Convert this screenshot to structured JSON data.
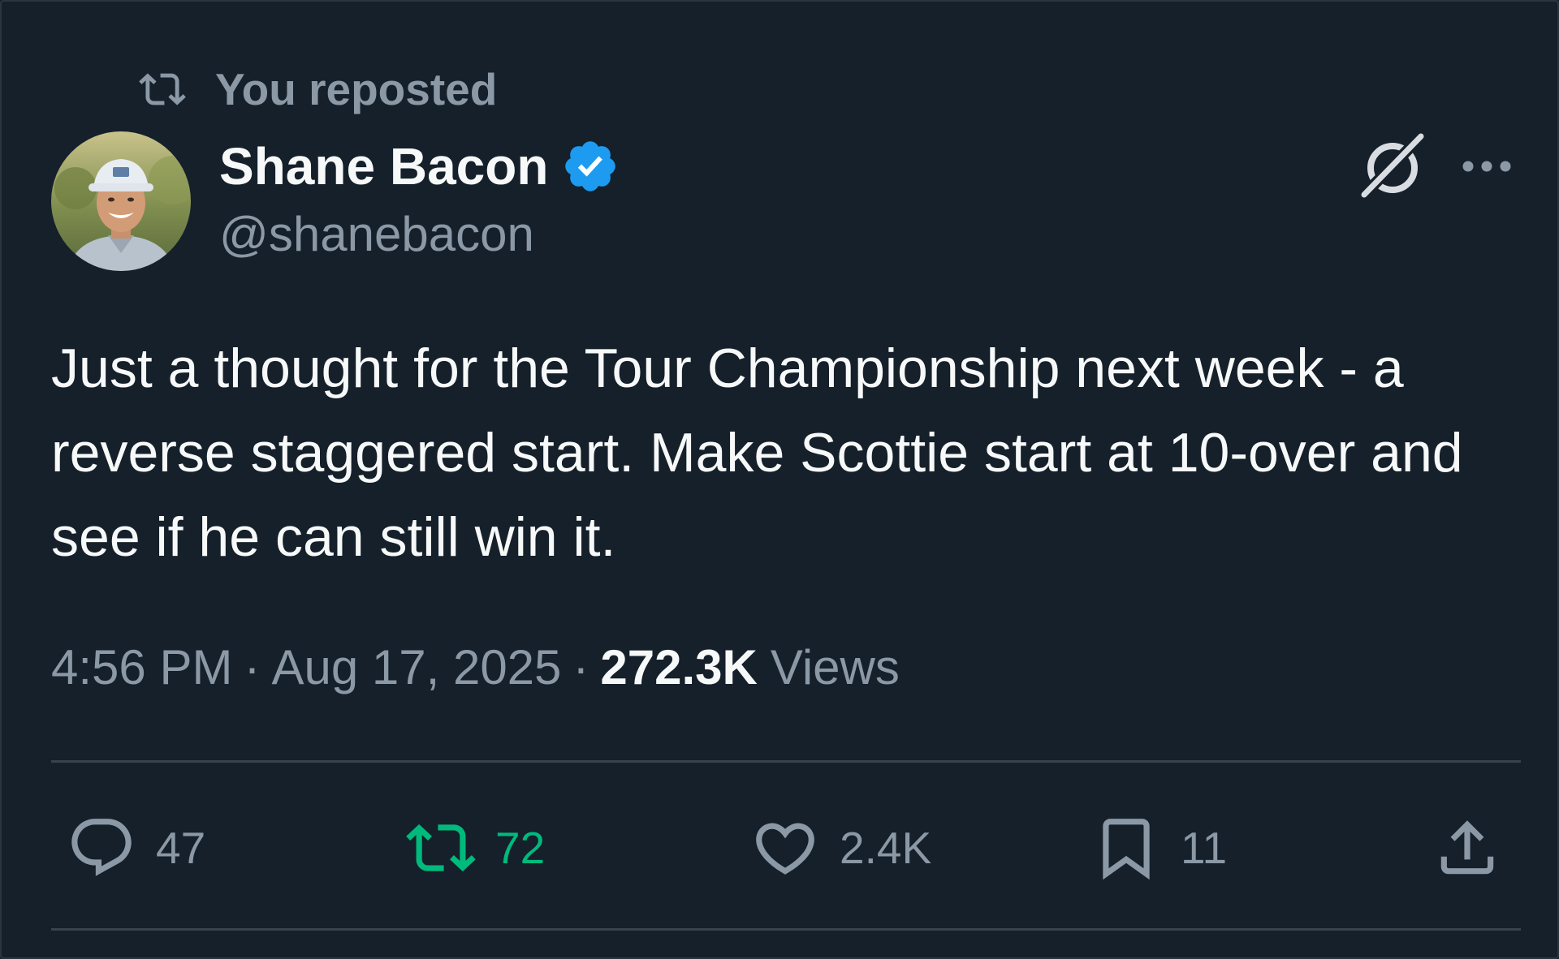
{
  "repost": {
    "label": "You reposted",
    "icon": "repost-icon"
  },
  "author": {
    "name": "Shane Bacon",
    "handle": "@shanebacon",
    "verified": true,
    "verified_color": "#1d9bf0"
  },
  "tweet": {
    "text": "Just a thought for the Tour Championship next week - a reverse staggered start. Make Scottie start at 10-over and see if he can still win it.",
    "time": "4:56 PM",
    "separator": "·",
    "date": "Aug 17, 2025",
    "views_count": "272.3K",
    "views_label": "Views"
  },
  "actions": {
    "replies": "47",
    "reposts": "72",
    "likes": "2.4K",
    "bookmarks": "11"
  },
  "colors": {
    "background": "#15202b",
    "text": "#f7f9f9",
    "muted": "#8b98a5",
    "repost_active": "#00ba7c",
    "divider": "#38444d"
  }
}
